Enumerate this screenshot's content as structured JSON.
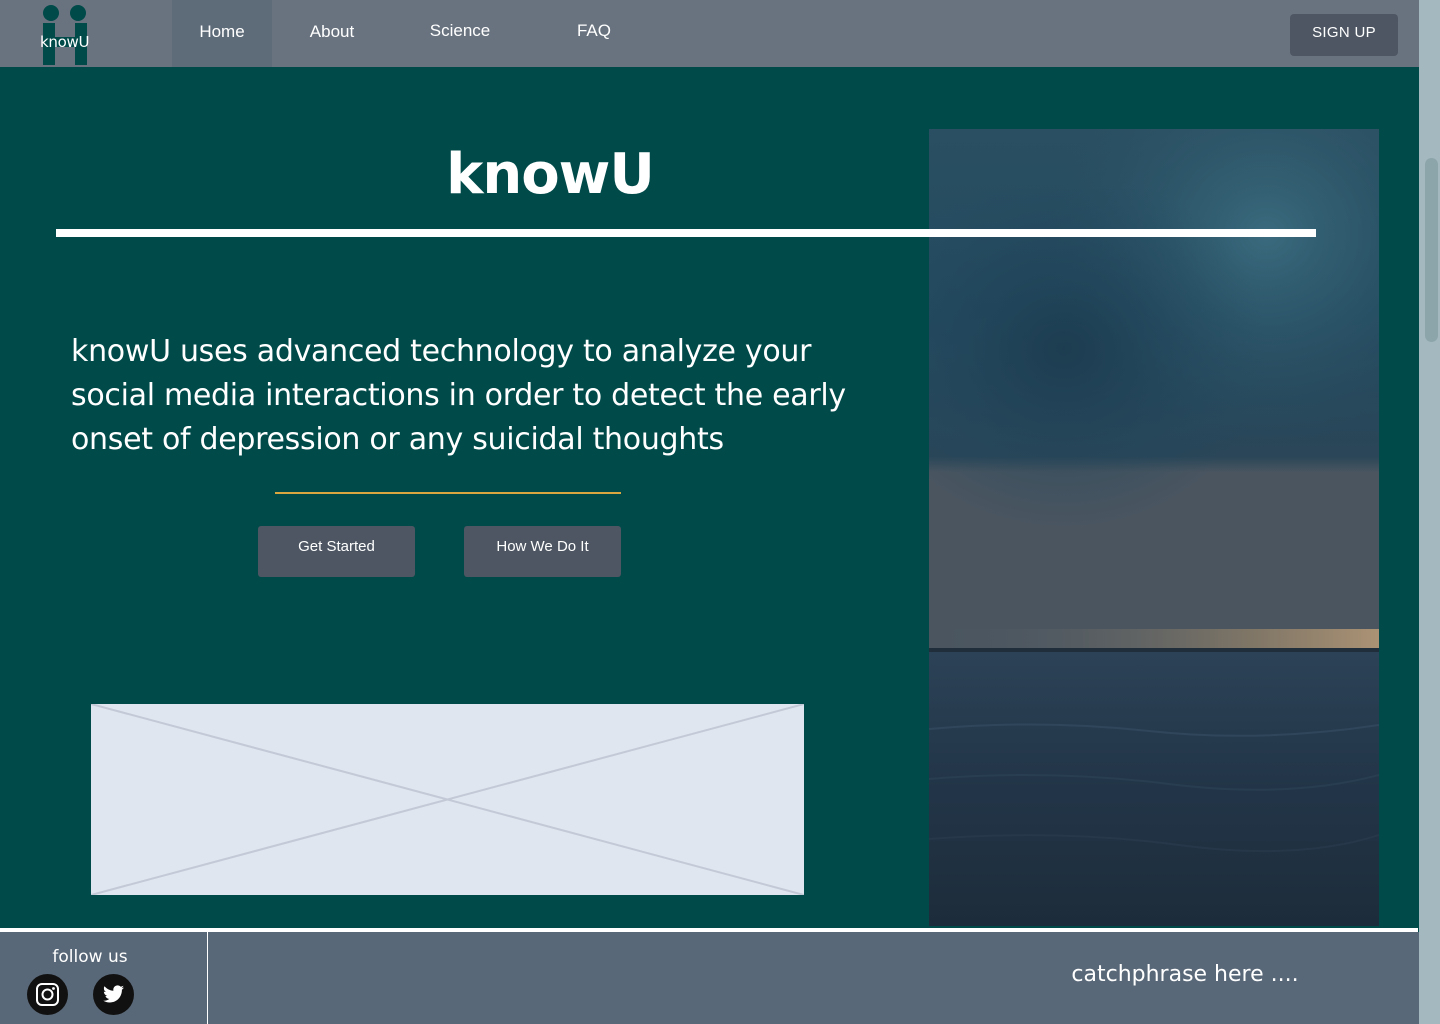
{
  "brand": {
    "logo_text": "knowU"
  },
  "nav": {
    "items": [
      {
        "label": "Home",
        "active": true
      },
      {
        "label": "About",
        "active": false
      },
      {
        "label": "Science",
        "active": false
      },
      {
        "label": "FAQ",
        "active": false
      }
    ],
    "signup_label": "SIGN UP"
  },
  "hero": {
    "title": "knowU",
    "description": "knowU uses advanced technology to analyze your social media interactions in order to detect the early onset of depression or any suicidal thoughts",
    "buttons": {
      "get_started": "Get Started",
      "how_we_do_it": "How We Do It"
    }
  },
  "footer": {
    "follow_label": "follow us",
    "social": [
      "instagram-icon",
      "twitter-icon"
    ],
    "catchphrase": "catchphrase here ...."
  },
  "colors": {
    "hero_background": "#004a4a",
    "navbar": "#69737f",
    "button": "#4d5662",
    "accent_rule": "#d9a640",
    "footer": "#596878"
  }
}
